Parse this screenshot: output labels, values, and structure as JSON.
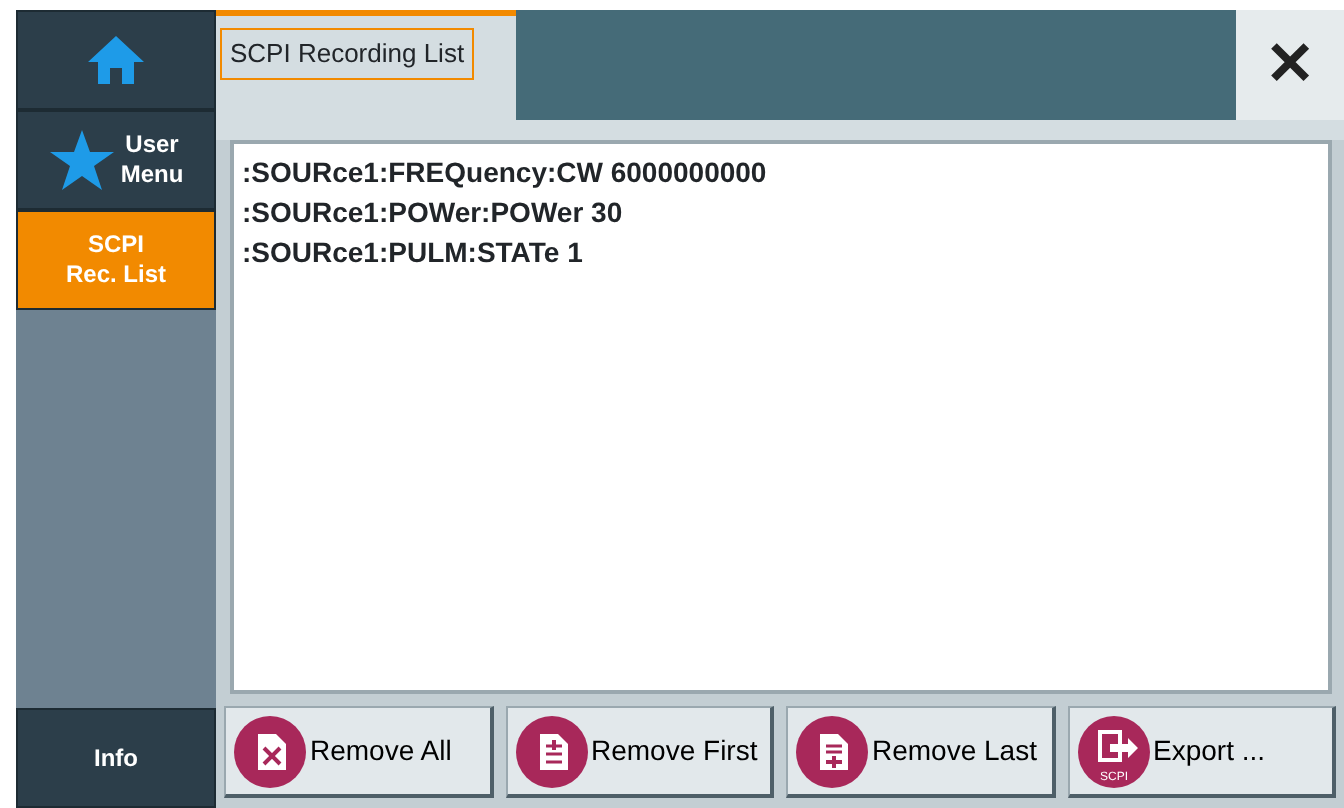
{
  "sidebar": {
    "items": [
      {
        "kind": "home",
        "selected": false
      },
      {
        "kind": "star",
        "label": "User\nMenu",
        "selected": false
      },
      {
        "kind": "text",
        "label": "SCPI\nRec. List",
        "selected": true
      }
    ],
    "bottom": {
      "label": "Info"
    }
  },
  "tabs": [
    {
      "label": "SCPI Recording List",
      "selected": true
    }
  ],
  "close": {
    "label": "✕"
  },
  "commands": [
    ":SOURce1:FREQuency:CW 6000000000",
    ":SOURce1:POWer:POWer 30",
    ":SOURce1:PULM:STATe 1"
  ],
  "buttons": [
    {
      "kind": "remove-all",
      "label": "Remove All"
    },
    {
      "kind": "remove-first",
      "label": "Remove First"
    },
    {
      "kind": "remove-last",
      "label": "Remove Last"
    },
    {
      "kind": "export",
      "label": "Export ...",
      "icon_text": "SCPI"
    }
  ]
}
